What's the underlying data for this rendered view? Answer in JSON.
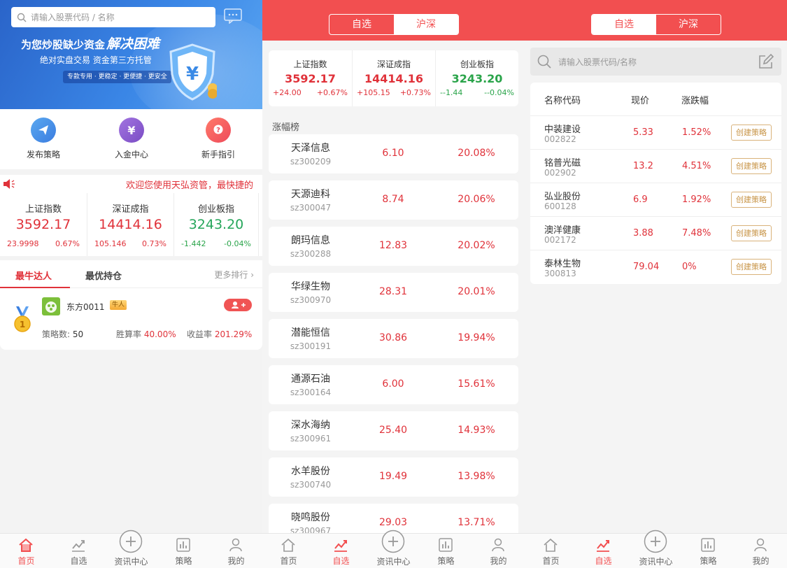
{
  "panel1": {
    "search_placeholder": "请输入股票代码 / 名称",
    "banner": {
      "title_lead": "为您炒股缺少资金",
      "title_emphasis": "解决困难",
      "subtitle": "绝对实盘交易   资金第三方托管",
      "tag": "专款专用 · 更稳定 · 更便捷 · 更安全"
    },
    "quick_links": [
      {
        "label": "发布策略",
        "icon": "paper-plane-icon",
        "color": "#4a90e2"
      },
      {
        "label": "入金中心",
        "icon": "yen-icon",
        "color": "#8e5ccf"
      },
      {
        "label": "新手指引",
        "icon": "question-icon",
        "color": "#f0555a"
      }
    ],
    "notice": "欢迎您使用天弘资管，最快捷的",
    "indices": [
      {
        "name": "上证指数",
        "price": "3592.17",
        "change": "23.9998",
        "pct": "0.67%",
        "color": "red"
      },
      {
        "name": "深证成指",
        "price": "14414.16",
        "change": "105.146",
        "pct": "0.73%",
        "color": "red"
      },
      {
        "name": "创业板指",
        "price": "3243.20",
        "change": "-1.442",
        "pct": "-0.04%",
        "color": "green"
      }
    ],
    "rank_tabs": [
      "最牛达人",
      "最优持仓"
    ],
    "more_label": "更多排行",
    "leader": {
      "name": "东方0011",
      "badge": "牛人",
      "strategy_label": "策略数:",
      "strategy_count": "50",
      "win_label": "胜算率",
      "win_rate": "40.00%",
      "return_label": "收益率",
      "return_rate": "201.29%",
      "medal": "1"
    }
  },
  "panel2": {
    "segments": [
      "自选",
      "沪深"
    ],
    "indices": [
      {
        "name": "上证指数",
        "price": "3592.17",
        "change": "+24.00",
        "pct": "+0.67%",
        "color": "red"
      },
      {
        "name": "深证成指",
        "price": "14414.16",
        "change": "+105.15",
        "pct": "+0.73%",
        "color": "red"
      },
      {
        "name": "创业板指",
        "price": "3243.20",
        "change": "--1.44",
        "pct": "--0.04%",
        "color": "green"
      }
    ],
    "list_title": "涨幅榜",
    "stocks": [
      {
        "name": "天泽信息",
        "code": "sz300209",
        "price": "6.10",
        "pct": "20.08%"
      },
      {
        "name": "天源迪科",
        "code": "sz300047",
        "price": "8.74",
        "pct": "20.06%"
      },
      {
        "name": "朗玛信息",
        "code": "sz300288",
        "price": "12.83",
        "pct": "20.02%"
      },
      {
        "name": "华绿生物",
        "code": "sz300970",
        "price": "28.31",
        "pct": "20.01%"
      },
      {
        "name": "潜能恒信",
        "code": "sz300191",
        "price": "30.86",
        "pct": "19.94%"
      },
      {
        "name": "通源石油",
        "code": "sz300164",
        "price": "6.00",
        "pct": "15.61%"
      },
      {
        "name": "深水海纳",
        "code": "sz300961",
        "price": "25.40",
        "pct": "14.93%"
      },
      {
        "name": "水羊股份",
        "code": "sz300740",
        "price": "19.49",
        "pct": "13.98%"
      },
      {
        "name": "晓鸣股份",
        "code": "sz300967",
        "price": "29.03",
        "pct": "13.71%"
      }
    ]
  },
  "panel3": {
    "segments": [
      "自选",
      "沪深"
    ],
    "search_placeholder": "请输入股票代码/名称",
    "headers": [
      "名称代码",
      "现价",
      "涨跌幅"
    ],
    "action_label": "创建策略",
    "rows": [
      {
        "name": "中装建设",
        "code": "002822",
        "price": "5.33",
        "pct": "1.52%"
      },
      {
        "name": "铭普光磁",
        "code": "002902",
        "price": "13.2",
        "pct": "4.51%"
      },
      {
        "name": "弘业股份",
        "code": "600128",
        "price": "6.9",
        "pct": "1.92%"
      },
      {
        "name": "澳洋健康",
        "code": "002172",
        "price": "3.88",
        "pct": "7.48%"
      },
      {
        "name": "泰林生物",
        "code": "300813",
        "price": "79.04",
        "pct": "0%"
      }
    ]
  },
  "nav": [
    {
      "label": "首页",
      "icon": "home-icon"
    },
    {
      "label": "自选",
      "icon": "trend-chart-icon"
    },
    {
      "label": "资讯中心",
      "icon": "plus-circle-icon"
    },
    {
      "label": "策略",
      "icon": "bar-chart-icon"
    },
    {
      "label": "我的",
      "icon": "user-icon"
    }
  ],
  "colors": {
    "accent": "#f24f50",
    "up": "#e0323a",
    "down": "#2aa44a",
    "gold": "#c89548"
  }
}
